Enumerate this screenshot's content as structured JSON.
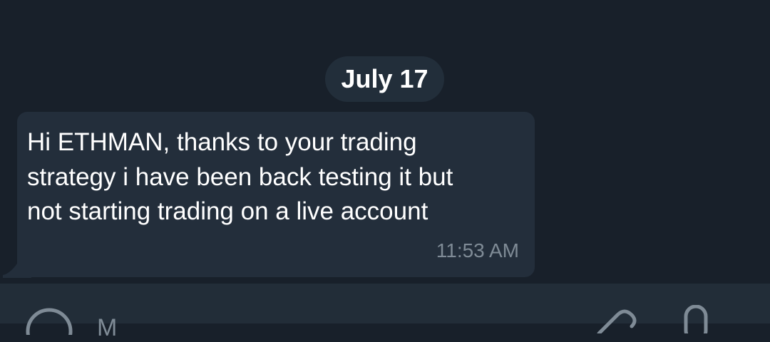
{
  "date_separator": "July 17",
  "message": {
    "lines": [
      "Hi ETHMAN, thanks to your trading",
      "strategy i have been back testing it but",
      "not starting trading on a live account"
    ],
    "time": "11:53 AM"
  },
  "input_bar": {
    "placeholder": "M",
    "icons": [
      "emoji-icon",
      "attach-icon",
      "microphone-icon"
    ]
  },
  "colors": {
    "background": "#18202a",
    "bubble": "#232e3b",
    "input_bar": "#222d38",
    "muted_text": "#7f8b96"
  }
}
